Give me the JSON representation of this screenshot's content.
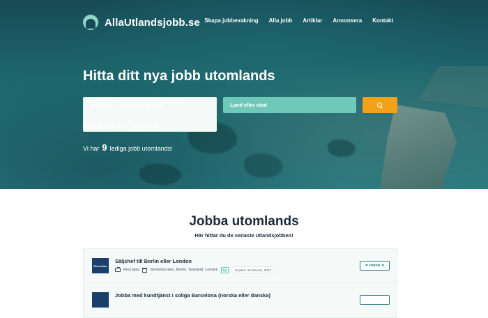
{
  "brand": {
    "name": "AllaUtlandsjobb.se"
  },
  "nav": {
    "items": [
      {
        "label": "Skapa jobbevakning"
      },
      {
        "label": "Alla jobb"
      },
      {
        "label": "Artiklar"
      },
      {
        "label": "Annonsera"
      },
      {
        "label": "Kontakt"
      }
    ]
  },
  "hero": {
    "headline": "Hitta ditt nya jobb utomlands",
    "search": {
      "job_placeholder": "Jobbtitel, sökord eller företag",
      "location_placeholder": "Land eller stad",
      "button_icon": "search-icon"
    },
    "browse_label": "Eller sök jobb via:",
    "browse_chip": "Kategori",
    "count_prefix": "Vi har",
    "count_value": "9",
    "count_suffix": "lediga jobb utomlands!"
  },
  "section": {
    "title": "Jobba utomlands",
    "subtitle": "Här hittar du de senaste utlandsjobben!"
  },
  "jobs": [
    {
      "logo_text": "Recruitas",
      "title": "Säljchef till Berlin eller London",
      "company": "Recruitas",
      "location": "Storbritannien, Berlin, Tyskland, London",
      "new_badge": "Ny",
      "expires": "Expires: 26 februari, 2023",
      "type": "★ Heltid ★"
    },
    {
      "logo_text": "",
      "title": "Jobba med kundtjänst i soliga Barcelona (norska eller danska)",
      "company": "",
      "location": "",
      "new_badge": "",
      "expires": "",
      "type": ""
    }
  ],
  "colors": {
    "hero_bg": "#1f6a70",
    "field_bg": "#6ec9b9",
    "search_button": "#f3a116",
    "text_dark": "#1b2b3a"
  }
}
